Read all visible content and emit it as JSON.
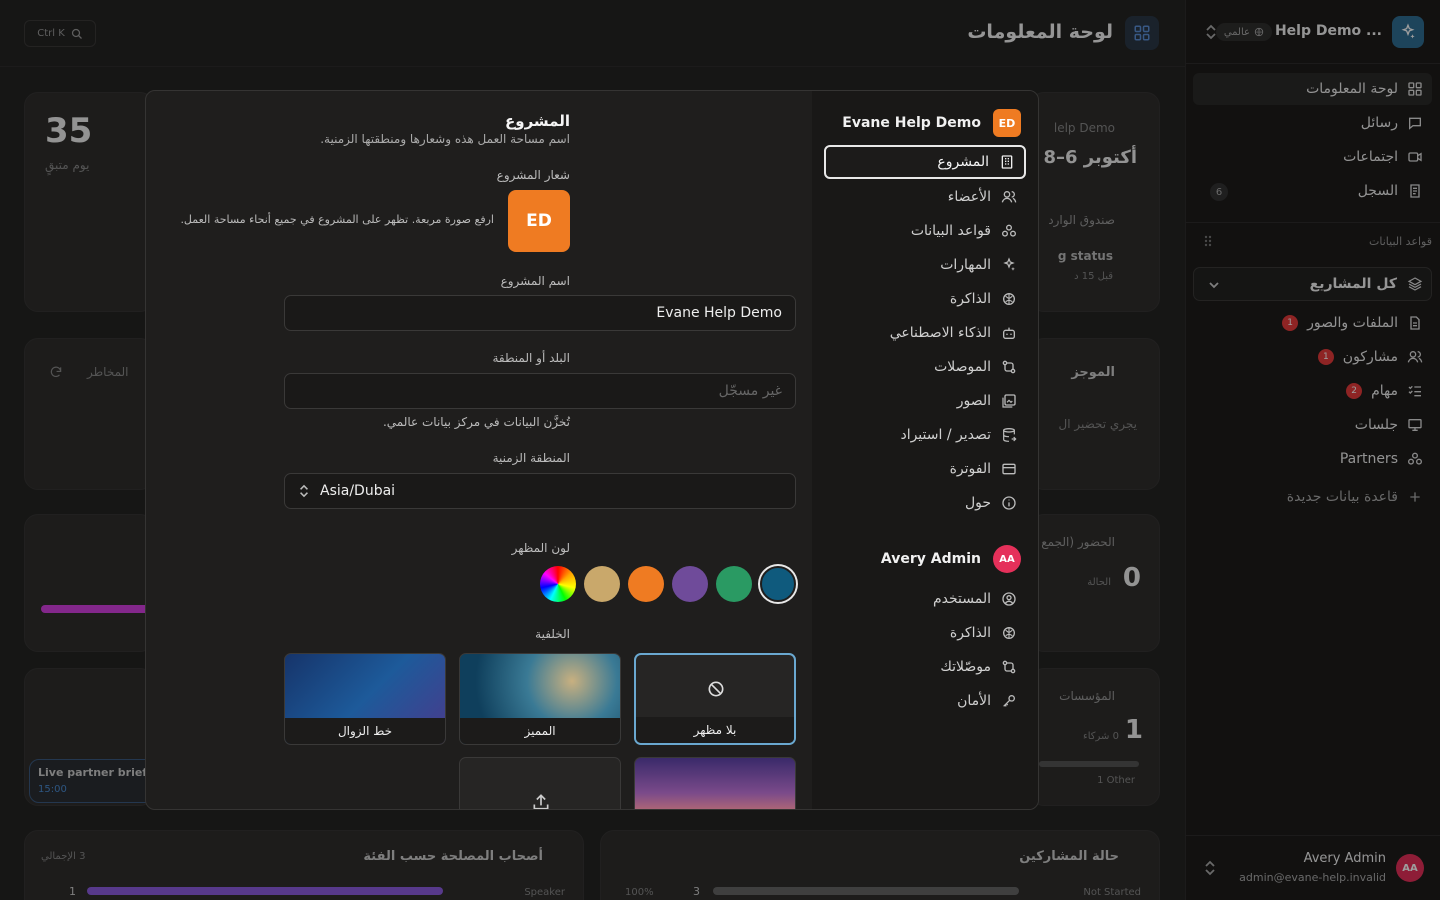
{
  "sidebar": {
    "project_name": "Help Demo ...",
    "scope_pill": "عالمي",
    "nav": [
      {
        "label": "لوحة المعلومات",
        "icon": "dashboard-icon"
      },
      {
        "label": "رسائل",
        "icon": "chat-icon"
      },
      {
        "label": "اجتماعات",
        "icon": "video-icon"
      },
      {
        "label": "السجل",
        "icon": "log-icon",
        "count": "6"
      }
    ],
    "databases_label": "قواعد البيانات",
    "all_projects": "كل المشاريع",
    "dbs": [
      {
        "label": "الملفات والصور",
        "icon": "file-icon",
        "badge": "1"
      },
      {
        "label": "مشاركون",
        "icon": "users-icon",
        "badge": "1"
      },
      {
        "label": "مهام",
        "icon": "checklist-icon",
        "badge": "2"
      },
      {
        "label": "جلسات",
        "icon": "presentation-icon"
      },
      {
        "label": "Partners",
        "icon": "partners-icon"
      }
    ],
    "new_db": "قاعدة بيانات جديدة",
    "user": {
      "name": "Avery Admin",
      "email": "admin@evane-help.invalid",
      "initials": "AA"
    }
  },
  "background": {
    "title": "لوحة المعلومات",
    "search_hint": "Ctrl K",
    "stat_value": "35",
    "stat_label": "يوم متبقٍ",
    "date_card": {
      "label": "lelp Demo",
      "value": "أكتوبر 6–8"
    },
    "inbox": "صندوق الوارد",
    "status_label": "g status",
    "status_time": "قبل 15 د",
    "risks": "المخاطر",
    "summary": "الموجز",
    "summary_text": "يجري تحضير ال",
    "attendance": "الحضور (الجمع",
    "attendance_value": "0",
    "attendance_sub": "الحالة",
    "orgs": "المؤسسات",
    "orgs_value": "1",
    "orgs_sub": "0 شركاء",
    "orgs_other": "1 Other",
    "live_title": "Live partner briefi",
    "live_time": "15:00",
    "stakeholders": "أصحاب المصلحة حسب الفئة",
    "stakeholders_total": "3 الإجمالي",
    "speaker_label": "Speaker",
    "speaker_count": "1",
    "participants_status": "حالة المشاركين",
    "not_started": "Not Started",
    "ns_count": "3",
    "ns_pct": "100%"
  },
  "modal": {
    "project_header": "Evane Help Demo",
    "project_initials": "ED",
    "project_menu": [
      {
        "label": "المشروع",
        "icon": "building-icon"
      },
      {
        "label": "الأعضاء",
        "icon": "members-icon"
      },
      {
        "label": "قواعد البيانات",
        "icon": "databases-icon"
      },
      {
        "label": "المهارات",
        "icon": "sparkle-icon"
      },
      {
        "label": "الذاكرة",
        "icon": "brain-icon"
      },
      {
        "label": "الذكاء الاصطناعي",
        "icon": "bot-icon"
      },
      {
        "label": "الموصلات",
        "icon": "connector-icon"
      },
      {
        "label": "الصور",
        "icon": "images-icon"
      },
      {
        "label": "تصدير / استيراد",
        "icon": "export-icon"
      },
      {
        "label": "الفوترة",
        "icon": "card-icon"
      },
      {
        "label": "حول",
        "icon": "info-icon"
      }
    ],
    "user_header": "Avery Admin",
    "user_initials": "AA",
    "user_menu": [
      {
        "label": "المستخدم",
        "icon": "user-circle-icon"
      },
      {
        "label": "الذاكرة",
        "icon": "brain-icon"
      },
      {
        "label": "موصّلاتك",
        "icon": "connector-icon"
      },
      {
        "label": "الأمان",
        "icon": "key-icon"
      }
    ],
    "content": {
      "title": "المشروع",
      "subtitle": "اسم مساحة العمل هذه وشعارها ومنطقتها الزمنية.",
      "logo_label": "شعار المشروع",
      "logo_initials": "ED",
      "logo_hint": "ارفع صورة مربعة. تظهر على المشروع في جميع أنحاء مساحة العمل.",
      "name_label": "اسم المشروع",
      "name_value": "Evane Help Demo",
      "region_label": "البلد أو المنطقة",
      "region_placeholder": "غير مسجّل",
      "region_hint": "تُخزَّن البيانات في مركز بيانات عالمي.",
      "tz_label": "المنطقة الزمنية",
      "tz_value": "Asia/Dubai",
      "color_label": "لون المظهر",
      "colors": [
        "#0f5a7d",
        "#2a9a63",
        "#6f4b9a",
        "#ef7b22",
        "#c9a86b"
      ],
      "bg_label": "الخلفية",
      "backgrounds": [
        "بلا مظهر",
        "المميز",
        "خط الزوال"
      ]
    }
  }
}
